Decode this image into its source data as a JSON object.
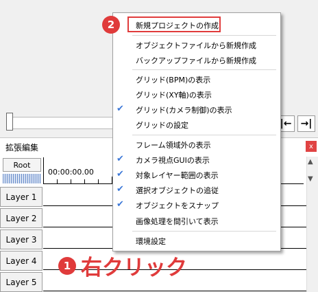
{
  "window": {
    "panel_title": "拡張編集",
    "close_label": "x",
    "root_label": "Root",
    "timecode": "00:00:00.00"
  },
  "nav": {
    "prev_label": "|←",
    "next_label": "→|"
  },
  "layers": [
    "Layer 1",
    "Layer 2",
    "Layer 3",
    "Layer 4",
    "Layer 5"
  ],
  "scroll": {
    "up": "▲",
    "down": "▼"
  },
  "context_menu": {
    "items": [
      {
        "label": "新規プロジェクトの作成",
        "checked": false,
        "highlighted": true
      },
      {
        "label": "オブジェクトファイルから新規作成",
        "checked": false
      },
      {
        "label": "バックアップファイルから新規作成",
        "checked": false
      },
      {
        "label": "グリッド(BPM)の表示",
        "checked": false
      },
      {
        "label": "グリッド(XY軸)の表示",
        "checked": false
      },
      {
        "label": "グリッド(カメラ制御)の表示",
        "checked": true
      },
      {
        "label": "グリッドの設定",
        "checked": false
      },
      {
        "label": "フレーム領域外の表示",
        "checked": false
      },
      {
        "label": "カメラ視点GUIの表示",
        "checked": true
      },
      {
        "label": "対象レイヤー範囲の表示",
        "checked": true
      },
      {
        "label": "選択オブジェクトの追従",
        "checked": true
      },
      {
        "label": "オブジェクトをスナップ",
        "checked": true
      },
      {
        "label": "画像処理を間引いて表示",
        "checked": false
      },
      {
        "label": "環境設定",
        "checked": false
      }
    ],
    "check_glyph": "✔"
  },
  "annotations": {
    "step1_number": "1",
    "step1_text": "右クリック",
    "step2_number": "2",
    "accent_color": "#e03b3b"
  }
}
